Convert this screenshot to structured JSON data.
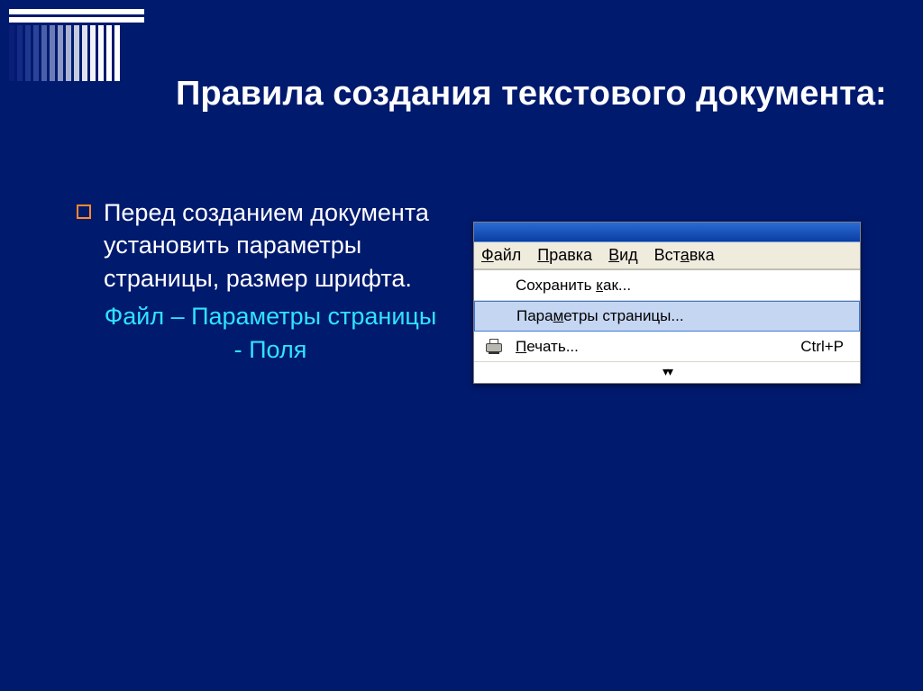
{
  "title": "Правила создания текстового документа:",
  "body": {
    "main_text": "Перед созданием документа установить параметры страницы, размер шрифта.",
    "cyan_text": "Файл – Параметры страницы - Поля"
  },
  "word": {
    "menubar": [
      "Файл",
      "Правка",
      "Вид",
      "Вставка"
    ],
    "dropdown": {
      "save_as": "Сохранить как...",
      "page_setup": "Параметры страницы...",
      "print": "Печать...",
      "print_shortcut": "Ctrl+P"
    }
  }
}
